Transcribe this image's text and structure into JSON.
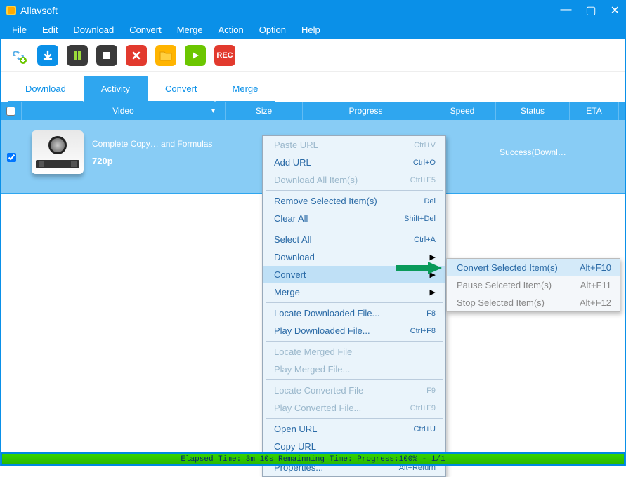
{
  "window": {
    "title": "Allavsoft"
  },
  "menubar": [
    "File",
    "Edit",
    "Download",
    "Convert",
    "Merge",
    "Action",
    "Option",
    "Help"
  ],
  "toolbar_icons": [
    "link",
    "down",
    "pause",
    "stop",
    "del",
    "folder",
    "play",
    "rec"
  ],
  "tabs": [
    {
      "label": "Download",
      "active": false
    },
    {
      "label": "Activity",
      "active": true
    },
    {
      "label": "Convert",
      "active": false
    },
    {
      "label": "Merge",
      "active": false
    }
  ],
  "columns": [
    "",
    "Video",
    "Size",
    "Progress",
    "Speed",
    "Status",
    "ETA"
  ],
  "rows": [
    {
      "checked": true,
      "title": "Complete Copy… and Formulas",
      "resolution": "720p",
      "size": "",
      "progress": "",
      "speed": "",
      "status": "Success(Downl…",
      "eta": ""
    }
  ],
  "statusbar": "Elapsed Time: 3m 10s Remainning Time: Progress:100% - 1/1",
  "context_menu": [
    {
      "label": "Paste URL",
      "shortcut": "Ctrl+V",
      "disabled": true
    },
    {
      "label": "Add URL",
      "shortcut": "Ctrl+O"
    },
    {
      "label": "Download All Item(s)",
      "shortcut": "Ctrl+F5",
      "disabled": true
    },
    {
      "sep": true
    },
    {
      "label": "Remove Selected Item(s)",
      "shortcut": "Del"
    },
    {
      "label": "Clear All",
      "shortcut": "Shift+Del"
    },
    {
      "sep": true
    },
    {
      "label": "Select All",
      "shortcut": "Ctrl+A"
    },
    {
      "label": "Download",
      "submenu": true
    },
    {
      "label": "Convert",
      "submenu": true,
      "highlight": true
    },
    {
      "label": "Merge",
      "submenu": true
    },
    {
      "sep": true
    },
    {
      "label": "Locate Downloaded File...",
      "shortcut": "F8"
    },
    {
      "label": "Play Downloaded File...",
      "shortcut": "Ctrl+F8"
    },
    {
      "sep": true
    },
    {
      "label": "Locate Merged File",
      "disabled": true
    },
    {
      "label": "Play Merged File...",
      "disabled": true
    },
    {
      "sep": true
    },
    {
      "label": "Locate Converted File",
      "shortcut": "F9",
      "disabled": true
    },
    {
      "label": "Play Converted File...",
      "shortcut": "Ctrl+F9",
      "disabled": true
    },
    {
      "sep": true
    },
    {
      "label": "Open URL",
      "shortcut": "Ctrl+U"
    },
    {
      "label": "Copy URL"
    },
    {
      "sep": true
    },
    {
      "label": "Properties...",
      "shortcut": "Alt+Return"
    }
  ],
  "convert_submenu": [
    {
      "label": "Convert Selected Item(s)",
      "shortcut": "Alt+F10",
      "enabled": true,
      "hl": true
    },
    {
      "label": "Pause Selceted Item(s)",
      "shortcut": "Alt+F11",
      "enabled": false
    },
    {
      "label": "Stop Selected Item(s)",
      "shortcut": "Alt+F12",
      "enabled": false
    }
  ],
  "rec_label": "REC"
}
